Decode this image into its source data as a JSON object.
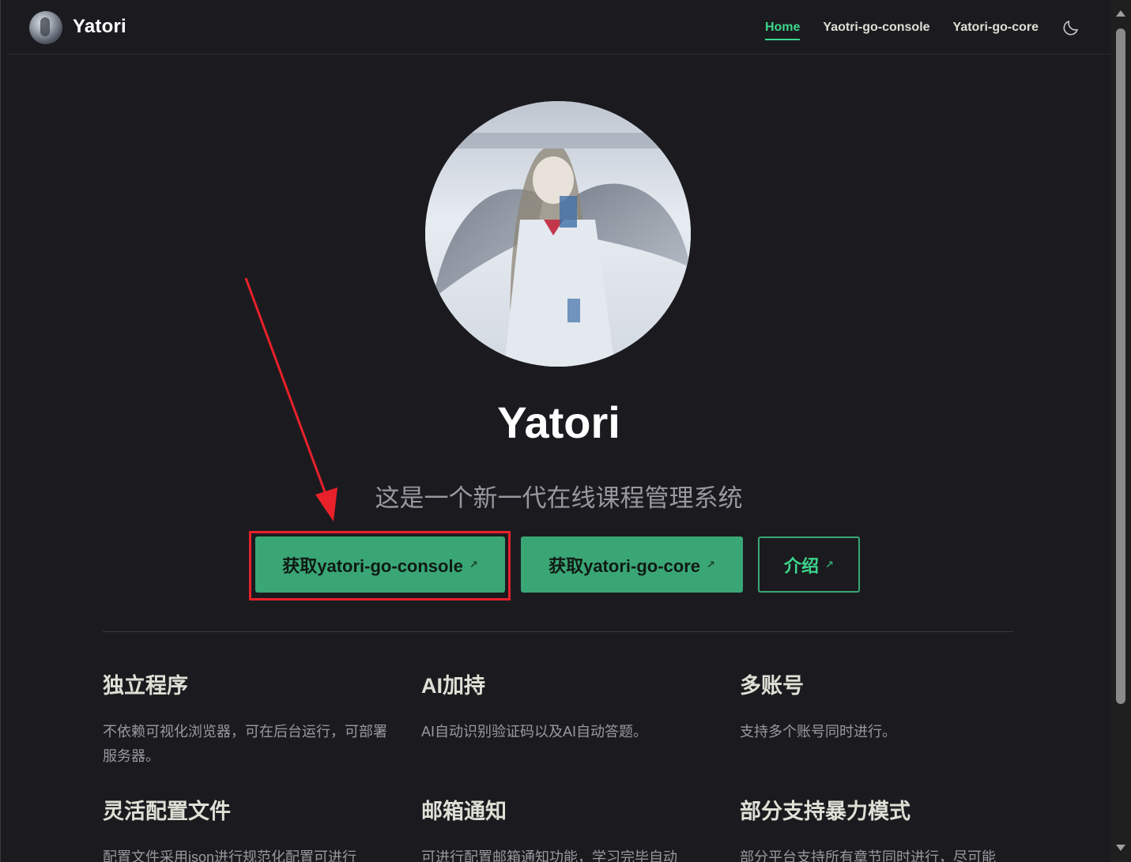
{
  "nav": {
    "brand": "Yatori",
    "links": [
      {
        "label": "Home",
        "active": true
      },
      {
        "label": "Yaotri-go-console",
        "active": false
      },
      {
        "label": "Yatori-go-core",
        "active": false
      }
    ],
    "theme_icon": "moon-icon"
  },
  "hero": {
    "title": "Yatori",
    "tagline": "这是一个新一代在线课程管理系统",
    "buttons": [
      {
        "label": "获取yatori-go-console",
        "style": "primary",
        "icon": "external-link-icon"
      },
      {
        "label": "获取yatori-go-core",
        "style": "primary",
        "icon": "external-link-icon"
      },
      {
        "label": "介绍",
        "style": "outline",
        "icon": "external-link-icon"
      }
    ],
    "external_glyph": "↗"
  },
  "features": [
    {
      "title": "独立程序",
      "details": "不依赖可视化浏览器，可在后台运行，可部署服务器。"
    },
    {
      "title": "AI加持",
      "details": "AI自动识别验证码以及AI自动答题。"
    },
    {
      "title": "多账号",
      "details": "支持多个账号同时进行。"
    },
    {
      "title": "灵活配置文件",
      "details": "配置文件采用json进行规范化配置可进行"
    },
    {
      "title": "邮箱通知",
      "details": "可进行配置邮箱通知功能，学习完毕自动"
    },
    {
      "title": "部分支持暴力模式",
      "details": "部分平台支持所有章节同时进行，尽可能"
    }
  ],
  "colors": {
    "background": "#1b1b1f",
    "brand_green": "#3aa675",
    "active_link": "#3dd68c",
    "annotation_red": "#e8212a"
  }
}
